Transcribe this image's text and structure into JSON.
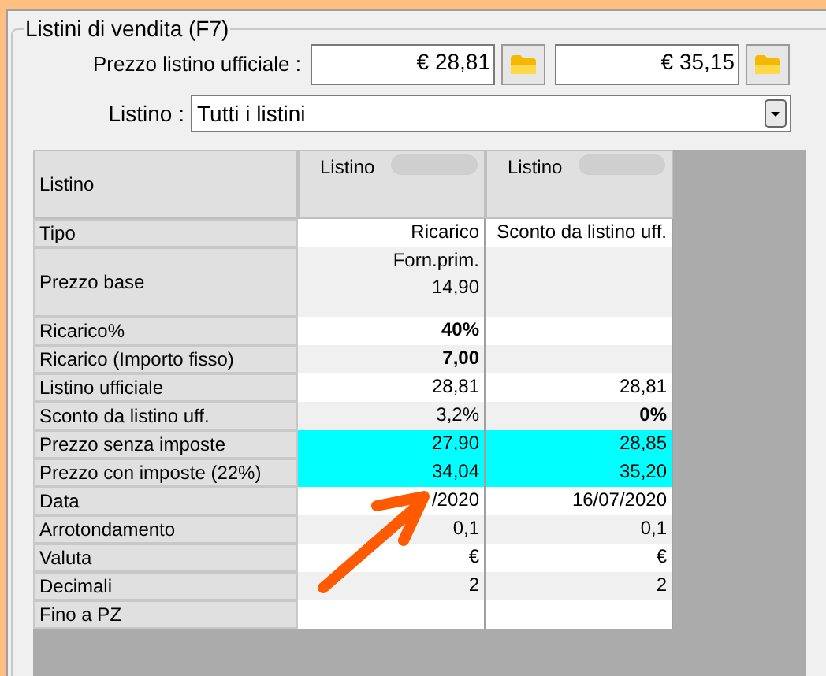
{
  "group": {
    "title": "Listini di vendita (F7)"
  },
  "official_price": {
    "label": "Prezzo listino ufficiale :",
    "values": [
      "€ 28,81",
      "€ 35,15"
    ]
  },
  "listino_select": {
    "label": "Listino :",
    "value": "Tutti i listini"
  },
  "grid": {
    "corner": "Listino",
    "columns": [
      "Listino",
      "Listino"
    ],
    "rows": [
      {
        "label": "Tipo",
        "highlighted": false,
        "cells": [
          {
            "text": "Ricarico",
            "bold": false
          },
          {
            "text": "Sconto da listino uff.",
            "bold": false
          }
        ]
      },
      {
        "label": "Prezzo base",
        "highlighted": false,
        "tall": true,
        "cells": [
          {
            "text": "Forn.prim.\n14,90",
            "bold": false
          },
          null
        ]
      },
      {
        "label": "Ricarico%",
        "highlighted": false,
        "cells": [
          {
            "text": "40%",
            "bold": true
          },
          null
        ]
      },
      {
        "label": "Ricarico (Importo fisso)",
        "highlighted": false,
        "cells": [
          {
            "text": "7,00",
            "bold": true
          },
          null
        ]
      },
      {
        "label": "Listino ufficiale",
        "highlighted": false,
        "cells": [
          {
            "text": "28,81",
            "bold": false
          },
          {
            "text": "28,81",
            "bold": false
          }
        ]
      },
      {
        "label": "Sconto da listino uff.",
        "highlighted": false,
        "cells": [
          {
            "text": "3,2%",
            "bold": false
          },
          {
            "text": "0%",
            "bold": true
          }
        ]
      },
      {
        "label": "Prezzo senza imposte",
        "highlighted": true,
        "cells": [
          {
            "text": "27,90",
            "bold": false
          },
          {
            "text": "28,85",
            "bold": false
          }
        ]
      },
      {
        "label": "Prezzo con imposte (22%)",
        "highlighted": true,
        "cells": [
          {
            "text": "34,04",
            "bold": false
          },
          {
            "text": "35,20",
            "bold": false
          }
        ]
      },
      {
        "label": "Data",
        "highlighted": false,
        "cells": [
          {
            "text": "/2020",
            "bold": false
          },
          {
            "text": "16/07/2020",
            "bold": false
          }
        ]
      },
      {
        "label": "Arrotondamento",
        "highlighted": false,
        "cells": [
          {
            "text": "0,1",
            "bold": false
          },
          {
            "text": "0,1",
            "bold": false
          }
        ]
      },
      {
        "label": "Valuta",
        "highlighted": false,
        "cells": [
          {
            "text": "€",
            "bold": false
          },
          {
            "text": "€",
            "bold": false
          }
        ]
      },
      {
        "label": "Decimali",
        "highlighted": false,
        "cells": [
          {
            "text": "2",
            "bold": false
          },
          {
            "text": "2",
            "bold": false
          }
        ]
      },
      {
        "label": "Fino a PZ",
        "highlighted": false,
        "cells": [
          null,
          null
        ]
      }
    ]
  }
}
